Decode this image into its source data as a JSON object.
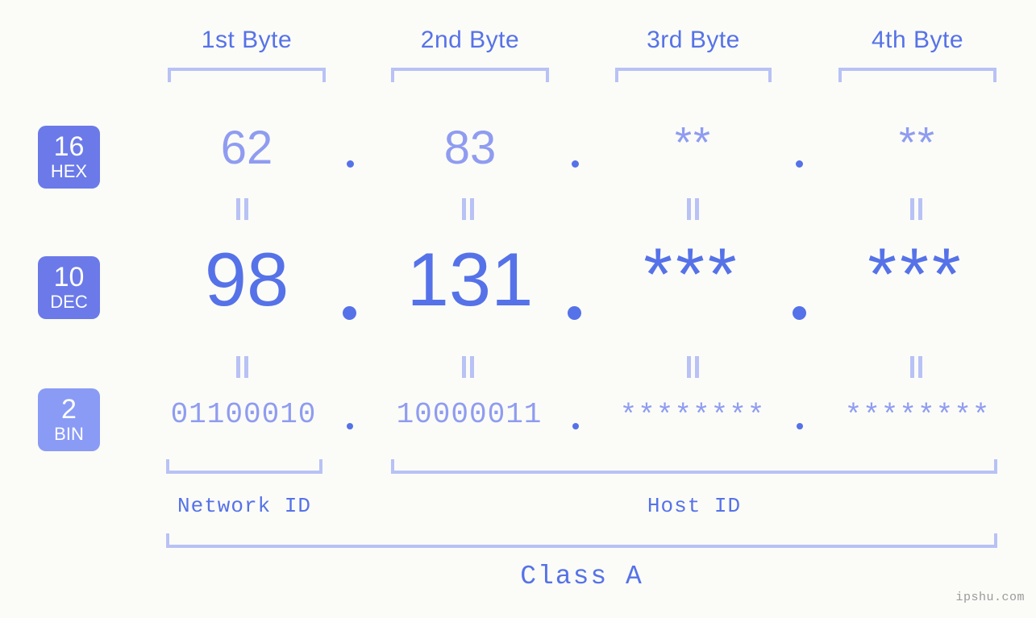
{
  "meta": {
    "background_color": "#fbfcf8",
    "accent_color": "#5672e8",
    "accent_light_color": "#8f9cf0",
    "bracket_color": "#b8c2f5",
    "badge_color": "#6b7ae8",
    "badge_light_color": "#8a9bf5",
    "watermark": "ipshu.com"
  },
  "headers": [
    {
      "label": "1st Byte"
    },
    {
      "label": "2nd Byte"
    },
    {
      "label": "3rd Byte"
    },
    {
      "label": "4th Byte"
    }
  ],
  "bases": [
    {
      "number": "16",
      "name": "HEX"
    },
    {
      "number": "10",
      "name": "DEC"
    },
    {
      "number": "2",
      "name": "BIN"
    }
  ],
  "rows": {
    "hex": {
      "base_number": "16",
      "base_name": "HEX",
      "values": [
        "62",
        "83",
        "**",
        "**"
      ],
      "separator": "."
    },
    "dec": {
      "base_number": "10",
      "base_name": "DEC",
      "values": [
        "98",
        "131",
        "***",
        "***"
      ],
      "separator": "."
    },
    "bin": {
      "base_number": "2",
      "base_name": "BIN",
      "values": [
        "01100010",
        "10000011",
        "********",
        "********"
      ],
      "separator": "."
    }
  },
  "equals_marks": {
    "symbol": "||",
    "count_per_row": 4
  },
  "sections": {
    "network_id": "Network ID",
    "host_id": "Host ID",
    "class": "Class A"
  }
}
